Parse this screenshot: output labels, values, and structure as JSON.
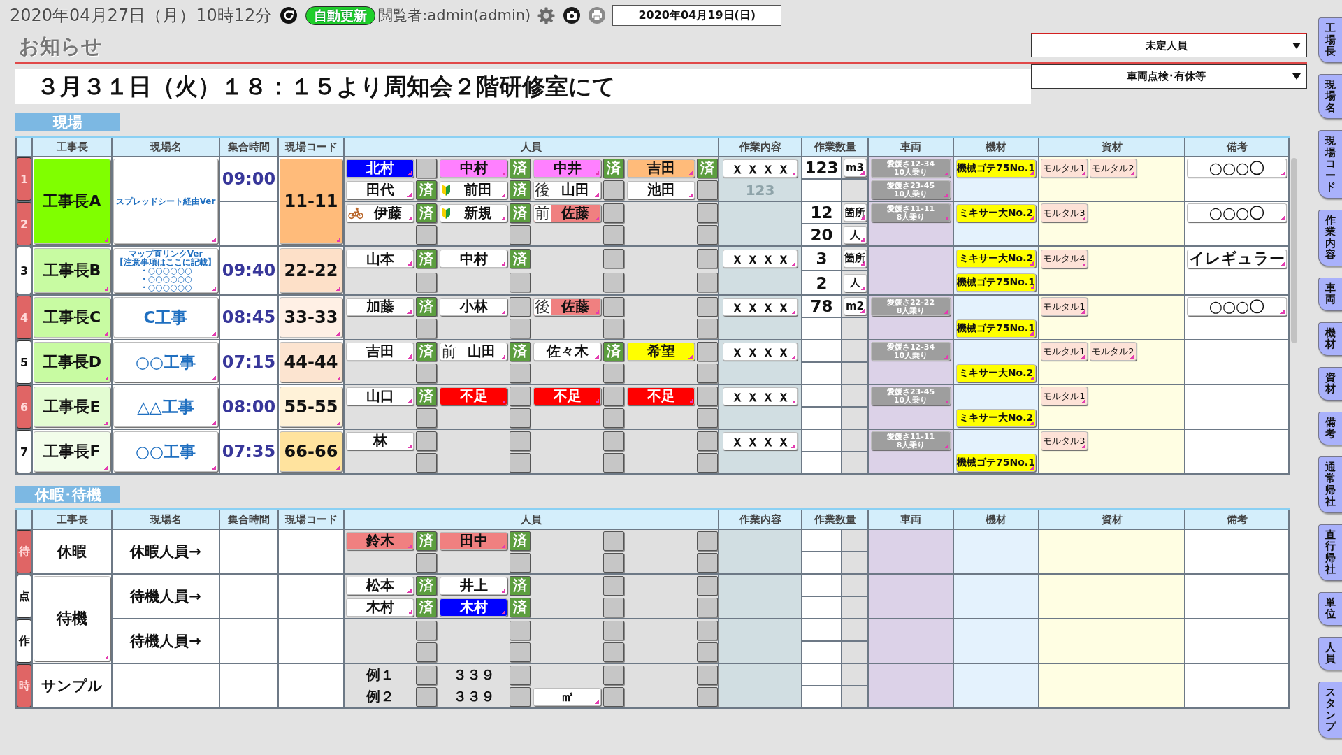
{
  "topbar": {
    "datetime": "2020年04月27日（月）10時12分",
    "auto_update": "自動更新",
    "viewer": "閲覧者:admin(admin)",
    "date": "2020年04月19日(日)"
  },
  "notice": {
    "title": "お知らせ",
    "message": "３月３１日（火）１８：１５より周知会２階研修室にて"
  },
  "dropdowns": [
    {
      "value": "未定人員"
    },
    {
      "value": "車両点検･有休等"
    }
  ],
  "sections": [
    {
      "title": "現場",
      "scrollable": true,
      "columns": [
        "工事長",
        "現場名",
        "集合時間",
        "現場コード",
        "人員",
        "作業内容",
        "作業数量",
        "車両",
        "機材",
        "資材",
        "備考"
      ],
      "groups": [
        {
          "leader": {
            "name": "工事長A",
            "color": "#80ff00"
          },
          "site": {
            "kind": "memo",
            "lines": [
              "スプレッドシート経由Ver"
            ]
          },
          "code": {
            "text": "11-11",
            "color": "#ffbb7a"
          },
          "blocks": [
            {
              "index": "1",
              "flagged": true,
              "time": "09:00",
              "lines": [
                {
                  "people": [
                    {
                      "kind": "chip",
                      "name": "北村",
                      "color": "#0000ff"
                    },
                    {
                      "kind": "chip",
                      "name": "中村",
                      "color": "#ff80ff",
                      "stamp": "済"
                    },
                    {
                      "kind": "chip",
                      "name": "中井",
                      "color": "#ff80ff",
                      "stamp": "済"
                    },
                    {
                      "kind": "chip",
                      "name": "吉田",
                      "color": "#ffbb7a",
                      "stamp": "済"
                    }
                  ],
                  "work": {
                    "kind": "chip",
                    "text": "ｘｘｘｘ"
                  },
                  "qty": "123",
                  "unit": "m3",
                  "vehicles": [
                    {
                      "plate": "愛媛さ12-34",
                      "capacity": "10人乗り"
                    }
                  ],
                  "equipment": [
                    "機械ゴテ75No.1"
                  ],
                  "materials": [
                    "モルタル1",
                    "モルタル2"
                  ],
                  "note": "○○○〇"
                },
                {
                  "people": [
                    {
                      "kind": "chip",
                      "name": "田代",
                      "color": "#ffffff",
                      "stamp": "済"
                    },
                    {
                      "kind": "chip",
                      "name": "前田",
                      "color": "#ffffff",
                      "badge": {
                        "kind": "beginner"
                      },
                      "stamp": "済"
                    },
                    {
                      "kind": "chip",
                      "prefix": "後",
                      "name": "山田",
                      "color": "#ffffff"
                    },
                    {
                      "kind": "chip",
                      "name": "池田",
                      "color": "#ffffff"
                    }
                  ],
                  "work": {
                    "kind": "hint",
                    "text": "123"
                  },
                  "vehicles": [
                    {
                      "plate": "愛媛さ23-45",
                      "capacity": "10人乗り"
                    }
                  ]
                }
              ]
            },
            {
              "index": "2",
              "flagged": true,
              "lines": [
                {
                  "people": [
                    {
                      "kind": "chip",
                      "name": "伊藤",
                      "color": "#ffffff",
                      "badge": {
                        "kind": "bicycle"
                      },
                      "stamp": "済"
                    },
                    {
                      "kind": "chip",
                      "name": "新規",
                      "color": "#ffffff",
                      "badge": {
                        "kind": "beginner"
                      },
                      "stamp": "済"
                    },
                    {
                      "kind": "chip",
                      "prefix": "前",
                      "name": "佐藤",
                      "color": "#f08080"
                    },
                    {
                      "kind": "empty"
                    }
                  ],
                  "qty": "12",
                  "unit": "箇所",
                  "vehicles": [
                    {
                      "plate": "愛媛さ11-11",
                      "capacity": "8人乗り"
                    }
                  ],
                  "equipment": [
                    "ミキサー大No.2"
                  ],
                  "materials": [
                    "モルタル3"
                  ],
                  "note": "○○○〇"
                },
                {
                  "people": [
                    {
                      "kind": "empty"
                    },
                    {
                      "kind": "empty"
                    },
                    {
                      "kind": "empty"
                    },
                    {
                      "kind": "empty"
                    }
                  ],
                  "qty": "20",
                  "unit": "人"
                }
              ]
            }
          ]
        },
        {
          "leader": {
            "name": "工事長B",
            "color": "#c8fba2"
          },
          "site": {
            "kind": "memo",
            "lines": [
              "マップ直リンクVer",
              "【注意事項はここに記載】",
              "・○○○○○○",
              "・○○○○○○",
              "・○○○○○○"
            ]
          },
          "code": {
            "text": "22-22",
            "color": "#fde0c8"
          },
          "blocks": [
            {
              "index": "3",
              "flagged": false,
              "time": "09:40",
              "lines": [
                {
                  "people": [
                    {
                      "kind": "chip",
                      "name": "山本",
                      "color": "#ffffff",
                      "stamp": "済"
                    },
                    {
                      "kind": "chip",
                      "name": "中村",
                      "color": "#ffffff",
                      "stamp": "済"
                    },
                    {
                      "kind": "empty"
                    },
                    {
                      "kind": "empty"
                    }
                  ],
                  "work": {
                    "kind": "chip",
                    "text": "ｘｘｘｘ"
                  },
                  "qty": "3",
                  "unit": "箇所",
                  "equipment": [
                    "ミキサー大No.2"
                  ],
                  "materials": [
                    "モルタル4"
                  ],
                  "note": "イレギュラー"
                },
                {
                  "people": [
                    {
                      "kind": "empty"
                    },
                    {
                      "kind": "empty"
                    },
                    {
                      "kind": "empty"
                    },
                    {
                      "kind": "empty"
                    }
                  ],
                  "qty": "2",
                  "unit": "人",
                  "equipment": [
                    "機械ゴテ75No.1"
                  ]
                }
              ]
            }
          ]
        },
        {
          "leader": {
            "name": "工事長C",
            "color": "#c8fba2"
          },
          "site": {
            "kind": "title",
            "text": "C工事"
          },
          "code": {
            "text": "33-33",
            "color": "#fff0e5"
          },
          "blocks": [
            {
              "index": "4",
              "flagged": true,
              "time": "08:45",
              "lines": [
                {
                  "people": [
                    {
                      "kind": "chip",
                      "name": "加藤",
                      "color": "#ffffff",
                      "stamp": "済"
                    },
                    {
                      "kind": "chip",
                      "name": "小林",
                      "color": "#ffffff"
                    },
                    {
                      "kind": "chip",
                      "prefix": "後",
                      "name": "佐藤",
                      "color": "#f08080"
                    },
                    {
                      "kind": "empty"
                    }
                  ],
                  "work": {
                    "kind": "chip",
                    "text": "ｘｘｘｘ"
                  },
                  "qty": "78",
                  "unit": "m2",
                  "vehicles": [
                    {
                      "plate": "愛媛さ22-22",
                      "capacity": "8人乗り"
                    }
                  ],
                  "materials": [
                    "モルタル1"
                  ],
                  "note": "○○○〇"
                },
                {
                  "people": [
                    {
                      "kind": "empty"
                    },
                    {
                      "kind": "empty"
                    },
                    {
                      "kind": "empty"
                    },
                    {
                      "kind": "empty"
                    }
                  ],
                  "equipment": [
                    "機械ゴテ75No.1"
                  ]
                }
              ]
            }
          ]
        },
        {
          "leader": {
            "name": "工事長D",
            "color": "#c8fba2"
          },
          "site": {
            "kind": "title",
            "text": "○○工事"
          },
          "code": {
            "text": "44-44",
            "color": "#fce4d0"
          },
          "blocks": [
            {
              "index": "5",
              "flagged": false,
              "time": "07:15",
              "lines": [
                {
                  "people": [
                    {
                      "kind": "chip",
                      "name": "吉田",
                      "color": "#ffffff",
                      "stamp": "済"
                    },
                    {
                      "kind": "chip",
                      "prefix": "前",
                      "name": "山田",
                      "color": "#ffffff",
                      "stamp": "済"
                    },
                    {
                      "kind": "chip",
                      "name": "佐々木",
                      "color": "#ffffff",
                      "stamp": "済"
                    },
                    {
                      "kind": "chip",
                      "name": "希望",
                      "color": "#ffff00"
                    }
                  ],
                  "work": {
                    "kind": "chip",
                    "text": "ｘｘｘｘ"
                  },
                  "vehicles": [
                    {
                      "plate": "愛媛さ12-34",
                      "capacity": "10人乗り"
                    }
                  ],
                  "materials": [
                    "モルタル1",
                    "モルタル2"
                  ]
                },
                {
                  "people": [
                    {
                      "kind": "empty"
                    },
                    {
                      "kind": "empty"
                    },
                    {
                      "kind": "empty"
                    },
                    {
                      "kind": "empty"
                    }
                  ],
                  "equipment": [
                    "ミキサー大No.2"
                  ]
                }
              ]
            }
          ]
        },
        {
          "leader": {
            "name": "工事長E",
            "color": "#e3fcd2"
          },
          "site": {
            "kind": "title",
            "text": "△△工事"
          },
          "code": {
            "text": "55-55",
            "color": "#fff2d8"
          },
          "blocks": [
            {
              "index": "6",
              "flagged": true,
              "time": "08:00",
              "lines": [
                {
                  "people": [
                    {
                      "kind": "chip",
                      "name": "山口",
                      "color": "#ffffff",
                      "stamp": "済"
                    },
                    {
                      "kind": "chip",
                      "name": "不足",
                      "color": "#ff0000"
                    },
                    {
                      "kind": "chip",
                      "name": "不足",
                      "color": "#ff0000"
                    },
                    {
                      "kind": "chip",
                      "name": "不足",
                      "color": "#ff0000"
                    }
                  ],
                  "work": {
                    "kind": "chip",
                    "text": "ｘｘｘｘ"
                  },
                  "vehicles": [
                    {
                      "plate": "愛媛さ23-45",
                      "capacity": "10人乗り"
                    }
                  ],
                  "materials": [
                    "モルタル1"
                  ]
                },
                {
                  "people": [
                    {
                      "kind": "empty"
                    },
                    {
                      "kind": "empty"
                    },
                    {
                      "kind": "empty"
                    },
                    {
                      "kind": "empty"
                    }
                  ],
                  "equipment": [
                    "ミキサー大No.2"
                  ]
                }
              ]
            }
          ]
        },
        {
          "leader": {
            "name": "工事長F",
            "color": "#f2fdea"
          },
          "site": {
            "kind": "title",
            "text": "○○工事"
          },
          "code": {
            "text": "66-66",
            "color": "#ffe39e"
          },
          "blocks": [
            {
              "index": "7",
              "flagged": false,
              "time": "07:35",
              "lines": [
                {
                  "people": [
                    {
                      "kind": "chip",
                      "name": "林",
                      "color": "#ffffff"
                    },
                    {
                      "kind": "empty"
                    },
                    {
                      "kind": "empty"
                    },
                    {
                      "kind": "empty"
                    }
                  ],
                  "work": {
                    "kind": "chip",
                    "text": "ｘｘｘｘ"
                  },
                  "vehicles": [
                    {
                      "plate": "愛媛さ11-11",
                      "capacity": "8人乗り"
                    }
                  ],
                  "materials": [
                    "モルタル3"
                  ]
                },
                {
                  "people": [
                    {
                      "kind": "empty"
                    },
                    {
                      "kind": "empty"
                    },
                    {
                      "kind": "empty"
                    },
                    {
                      "kind": "empty"
                    }
                  ],
                  "equipment": [
                    "機械ゴテ75No.1"
                  ]
                }
              ]
            }
          ]
        }
      ]
    },
    {
      "title": "休暇･待機",
      "scrollable": false,
      "columns": [
        "工事長",
        "現場名",
        "集合時間",
        "現場コード",
        "人員",
        "作業内容",
        "作業数量",
        "車両",
        "機材",
        "資材",
        "備考"
      ],
      "groups": [
        {
          "leader": {
            "name": "休暇"
          },
          "blocks": [
            {
              "index": "待",
              "flagged": true,
              "site": {
                "kind": "label",
                "text": "休暇人員→"
              },
              "lines": [
                {
                  "people": [
                    {
                      "kind": "chip",
                      "name": "鈴木",
                      "color": "#f08080",
                      "stamp": "済"
                    },
                    {
                      "kind": "chip",
                      "name": "田中",
                      "color": "#f08080",
                      "stamp": "済"
                    },
                    {
                      "kind": "empty"
                    },
                    {
                      "kind": "empty"
                    }
                  ]
                },
                {
                  "people": [
                    {
                      "kind": "empty"
                    },
                    {
                      "kind": "empty"
                    },
                    {
                      "kind": "empty"
                    },
                    {
                      "kind": "empty"
                    }
                  ]
                }
              ]
            }
          ]
        },
        {
          "leader": {
            "name": "待機",
            "color": "#ffffff"
          },
          "blocks": [
            {
              "index": "点",
              "flagged": false,
              "site": {
                "kind": "label",
                "text": "待機人員→"
              },
              "lines": [
                {
                  "people": [
                    {
                      "kind": "chip",
                      "name": "松本",
                      "color": "#ffffff",
                      "stamp": "済"
                    },
                    {
                      "kind": "chip",
                      "name": "井上",
                      "color": "#ffffff",
                      "stamp": "済"
                    },
                    {
                      "kind": "empty"
                    },
                    {
                      "kind": "empty"
                    }
                  ]
                },
                {
                  "people": [
                    {
                      "kind": "chip",
                      "name": "木村",
                      "color": "#ffffff",
                      "stamp": "済"
                    },
                    {
                      "kind": "chip",
                      "name": "木村",
                      "color": "#0000ff",
                      "stamp": "済"
                    },
                    {
                      "kind": "empty"
                    },
                    {
                      "kind": "empty"
                    }
                  ]
                }
              ]
            },
            {
              "index": "作",
              "flagged": false,
              "site": {
                "kind": "label",
                "text": "待機人員→"
              },
              "lines": [
                {
                  "people": [
                    {
                      "kind": "empty"
                    },
                    {
                      "kind": "empty"
                    },
                    {
                      "kind": "empty"
                    },
                    {
                      "kind": "empty"
                    }
                  ]
                },
                {
                  "people": [
                    {
                      "kind": "empty"
                    },
                    {
                      "kind": "empty"
                    },
                    {
                      "kind": "empty"
                    },
                    {
                      "kind": "empty"
                    }
                  ]
                }
              ]
            }
          ]
        },
        {
          "leader": {
            "name": "サンプル"
          },
          "blocks": [
            {
              "index": "時",
              "flagged": true,
              "lines": [
                {
                  "people": [
                    {
                      "kind": "text",
                      "name": "例１"
                    },
                    {
                      "kind": "text",
                      "name": "３３９"
                    },
                    {
                      "kind": "empty"
                    },
                    {
                      "kind": "empty"
                    }
                  ]
                },
                {
                  "people": [
                    {
                      "kind": "text",
                      "name": "例２"
                    },
                    {
                      "kind": "text",
                      "name": "３３９"
                    },
                    {
                      "kind": "chip",
                      "name": "㎡",
                      "color": "#ffffff"
                    },
                    {
                      "kind": "empty"
                    }
                  ]
                }
              ]
            }
          ]
        }
      ]
    }
  ],
  "side_tabs": [
    "工場長",
    "現場名",
    "現場コード",
    "作業内容",
    "車両",
    "機材",
    "資材",
    "備考",
    "通常帰社",
    "直行帰社",
    "単位",
    "人員",
    "スタンプ"
  ]
}
